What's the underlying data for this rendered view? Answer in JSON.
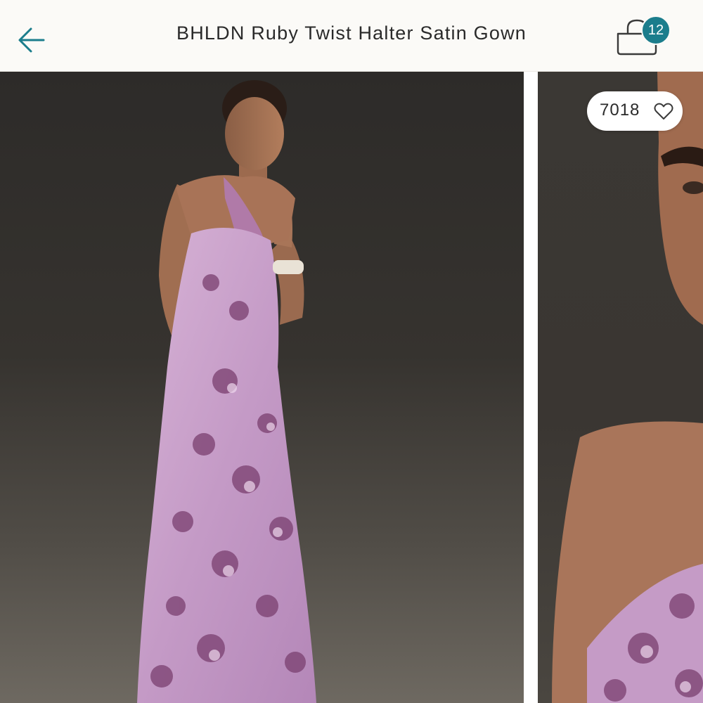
{
  "header": {
    "title": "BHLDN Ruby Twist Halter Satin Gown",
    "back_icon": "arrow-left-icon",
    "cart_icon": "shopping-bag-icon",
    "cart_count": "12"
  },
  "gallery": {
    "like_count": "7018",
    "like_icon": "heart-outline-icon",
    "slides": [
      {
        "content": "model full-length in lilac floral satin halter gown"
      },
      {
        "content": "close-up of model shoulder and face"
      }
    ]
  },
  "colors": {
    "accent": "#1b7d8c",
    "header_bg": "#fbfaf7",
    "photo_bg": "#33302d",
    "gown": "#c79fc8"
  }
}
